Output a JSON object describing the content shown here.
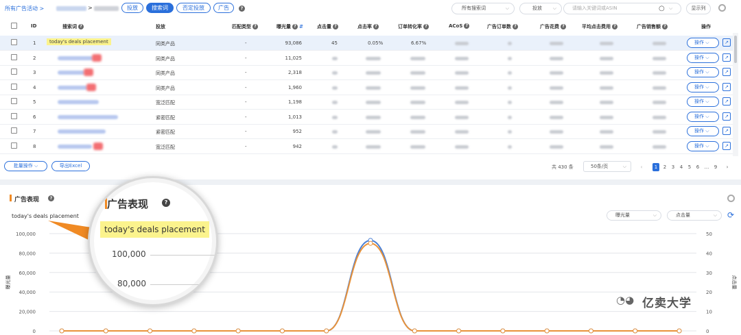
{
  "toolbar": {
    "crumb_root": "所有广告活动 >",
    "crumb_sep": ">",
    "tabs": [
      {
        "label": "投放",
        "active": false
      },
      {
        "label": "搜索词",
        "active": true
      },
      {
        "label": "否定投放",
        "active": false
      },
      {
        "label": "广告",
        "active": false
      }
    ],
    "filter_select": "所有搜索词",
    "field_select": "投放",
    "search_placeholder": "请输入关键词或ASIN",
    "columns_btn": "显示列"
  },
  "table": {
    "headers": [
      "ID",
      "搜索词",
      "投放",
      "匹配类型",
      "曝光量",
      "点击量",
      "点击率",
      "订单转化率",
      "ACoS",
      "广告订单数",
      "广告花费",
      "平均点击费用",
      "广告销售额",
      "操作"
    ],
    "rows": [
      {
        "id": "1",
        "keyword": "today's deals placement",
        "targeting": "同类产品",
        "match": "-",
        "impressions": "93,086",
        "clicks": "45",
        "ctr": "0.05%",
        "cvr": "6.67%",
        "selected": true
      },
      {
        "id": "2",
        "keyword": "",
        "targeting": "同类产品",
        "match": "-",
        "impressions": "11,025"
      },
      {
        "id": "3",
        "keyword": "",
        "targeting": "同类产品",
        "match": "-",
        "impressions": "2,318"
      },
      {
        "id": "4",
        "keyword": "",
        "targeting": "同类产品",
        "match": "-",
        "impressions": "1,960"
      },
      {
        "id": "5",
        "keyword": "",
        "targeting": "宽泛匹配",
        "match": "-",
        "impressions": "1,198"
      },
      {
        "id": "6",
        "keyword": "",
        "targeting": "紧密匹配",
        "match": "-",
        "impressions": "1,013"
      },
      {
        "id": "7",
        "keyword": "",
        "targeting": "紧密匹配",
        "match": "-",
        "impressions": "952"
      },
      {
        "id": "8",
        "keyword": "",
        "targeting": "宽泛匹配",
        "match": "-",
        "impressions": "942"
      }
    ],
    "op_label": "操作"
  },
  "footer": {
    "bulk_label": "批量操作",
    "export_label": "导出Excel",
    "total": "共 430 条",
    "page_size": "50条/页",
    "pages": [
      "1",
      "2",
      "3",
      "4",
      "5",
      "6",
      "...",
      "9"
    ],
    "active_page": "1"
  },
  "performance": {
    "title": "广告表现",
    "keyword_label": "today's deals placement",
    "metric_left": "曝光量",
    "metric_right": "点击量",
    "y_left_label": "曝光量",
    "y_right_label": "点击量"
  },
  "magnifier": {
    "title": "广告表现",
    "highlight": "today's deals placement",
    "tick_a": "100,000",
    "tick_b": "80,000"
  },
  "watermark": "亿卖大学",
  "colors": {
    "accent": "#2a6fdb",
    "impressions": "#4a7fd4",
    "clicks": "#e8923a",
    "orange": "#f08a24"
  },
  "chart_data": {
    "type": "line",
    "y_left_ticks": [
      "0",
      "20,000",
      "40,000",
      "60,000",
      "80,000",
      "100,000"
    ],
    "y_right_ticks": [
      "0",
      "10",
      "20",
      "30",
      "40",
      "50"
    ],
    "ylim_left": [
      0,
      100000
    ],
    "ylim_right": [
      0,
      50
    ],
    "series": [
      {
        "name": "曝光量",
        "values": [
          0,
          0,
          0,
          0,
          0,
          0,
          0,
          93086,
          0,
          0,
          0,
          0,
          0,
          0,
          0
        ]
      },
      {
        "name": "点击量",
        "values": [
          0,
          0,
          0,
          0,
          0,
          0,
          0,
          45,
          0,
          0,
          0,
          0,
          0,
          0,
          0
        ]
      }
    ],
    "grid": true
  }
}
